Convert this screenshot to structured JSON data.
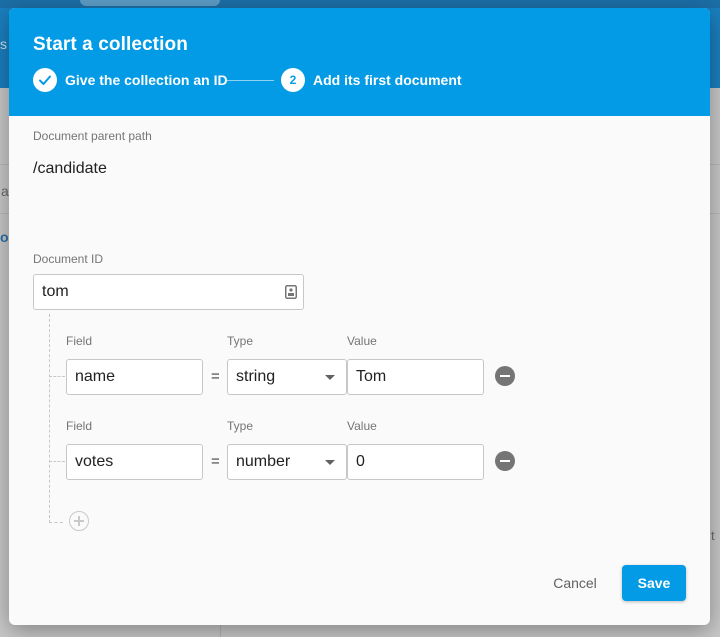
{
  "background": {
    "fragments": {
      "top_left": "s",
      "row_left": "a",
      "link_left": "ol",
      "right_edge": "t"
    }
  },
  "dialog": {
    "title": "Start a collection",
    "steps": [
      {
        "badge": "✓",
        "label": "Give the collection an ID",
        "state": "complete"
      },
      {
        "badge": "2",
        "label": "Add its first document",
        "state": "active"
      }
    ],
    "parent_path": {
      "label": "Document parent path",
      "value": "/candidate"
    },
    "document_id": {
      "label": "Document ID",
      "value": "tom"
    },
    "column_labels": {
      "field": "Field",
      "type": "Type",
      "value": "Value"
    },
    "fields": [
      {
        "field": "name",
        "operator": "=",
        "type": "string",
        "value": "Tom"
      },
      {
        "field": "votes",
        "operator": "=",
        "type": "number",
        "value": "0"
      }
    ],
    "actions": {
      "cancel": "Cancel",
      "save": "Save"
    }
  },
  "colors": {
    "accent": "#039be5",
    "header_text": "#ffffff",
    "remove_icon": "#757575"
  }
}
